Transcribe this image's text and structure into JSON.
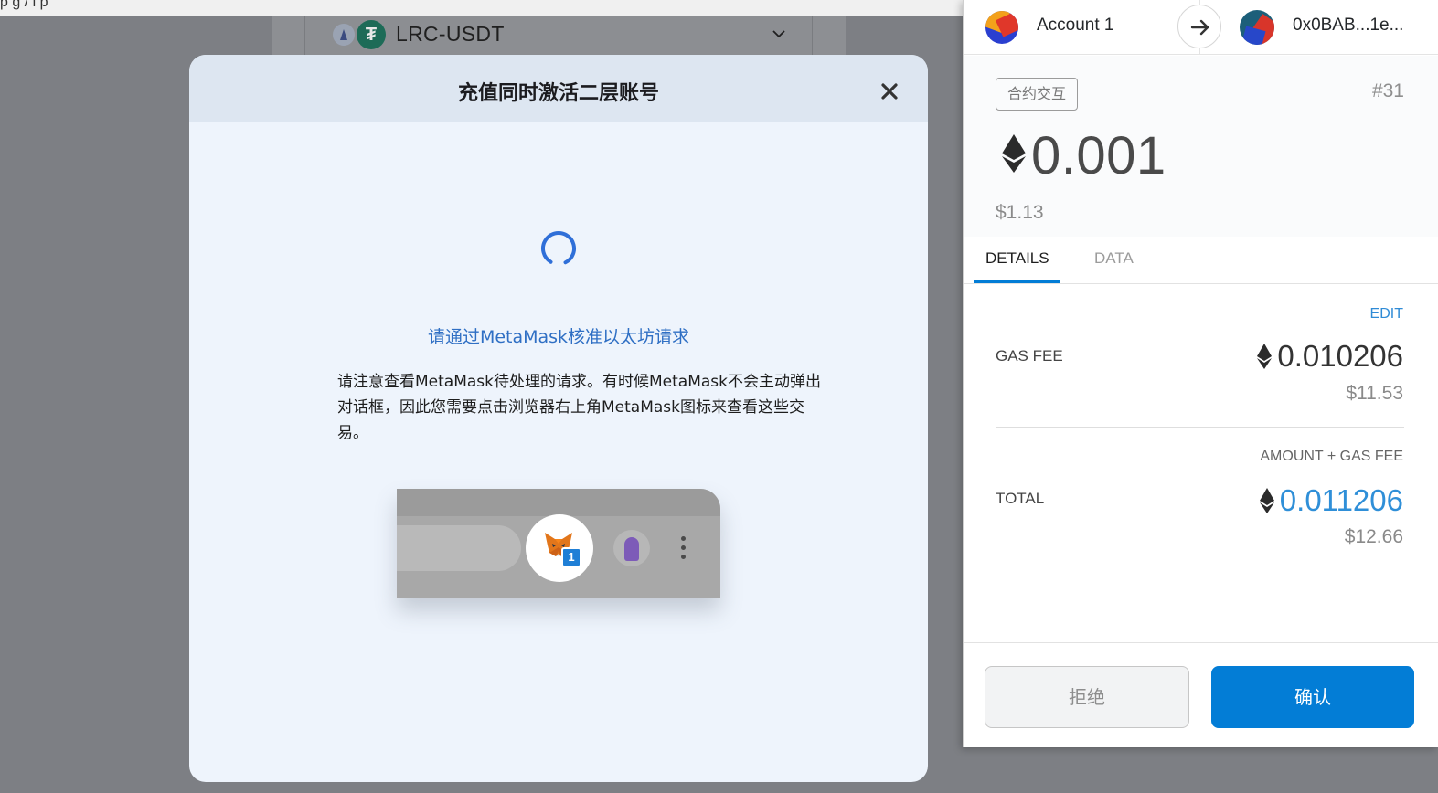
{
  "background_page": {
    "url_fragment": "p  g  /  i  p",
    "pair_selector": {
      "label": "LRC-USDT"
    }
  },
  "modal": {
    "title": "充值同时激活二层账号",
    "status": "请通过MetaMask核准以太坊请求",
    "note": "请注意查看MetaMask待处理的请求。有时候MetaMask不会主动弹出对话框，因此您需要点击浏览器右上角MetaMask图标来查看这些交易。",
    "illustration": {
      "badge_count": "1"
    }
  },
  "metamask": {
    "account_name": "Account 1",
    "to_address": "0x0BAB...1e...",
    "tx_type": "合约交互",
    "nonce": "#31",
    "amount": "0.001",
    "amount_fiat": "$1.13",
    "tabs": [
      {
        "label": "DETAILS",
        "active": true
      },
      {
        "label": "DATA",
        "active": false
      }
    ],
    "edit_label": "EDIT",
    "gas_fee_label": "GAS FEE",
    "gas_fee_value": "0.010206",
    "gas_fee_fiat": "$11.53",
    "amount_plus_gas_label": "AMOUNT + GAS FEE",
    "total_label": "TOTAL",
    "total_value": "0.011206",
    "total_fiat": "$12.66",
    "reject_label": "拒绝",
    "confirm_label": "确认",
    "colors": {
      "primary": "#037dd6",
      "total_value": "#2f8fd8"
    }
  }
}
